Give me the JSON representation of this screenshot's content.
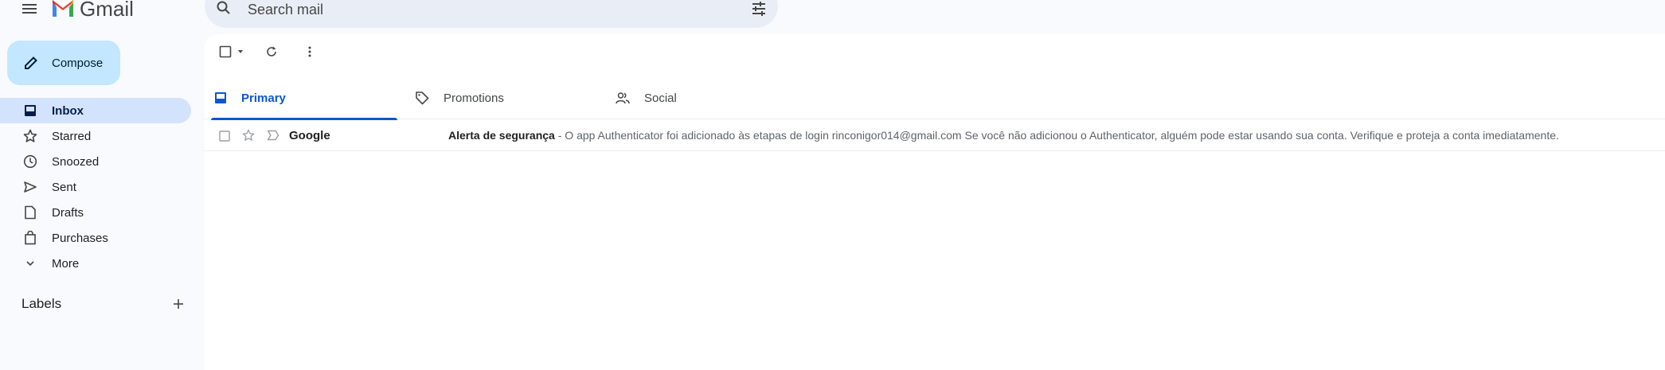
{
  "app": {
    "name": "Gmail"
  },
  "search": {
    "placeholder": "Search mail"
  },
  "compose": {
    "label": "Compose"
  },
  "nav": {
    "items": [
      {
        "label": "Inbox",
        "icon": "inbox-icon"
      },
      {
        "label": "Starred",
        "icon": "star-icon"
      },
      {
        "label": "Snoozed",
        "icon": "clock-icon"
      },
      {
        "label": "Sent",
        "icon": "send-icon"
      },
      {
        "label": "Drafts",
        "icon": "draft-icon"
      },
      {
        "label": "Purchases",
        "icon": "shopping-bag-icon"
      },
      {
        "label": "More",
        "icon": "chevron-down-icon"
      }
    ]
  },
  "labels": {
    "title": "Labels"
  },
  "tabs": [
    {
      "label": "Primary",
      "icon": "inbox-icon"
    },
    {
      "label": "Promotions",
      "icon": "tag-icon"
    },
    {
      "label": "Social",
      "icon": "people-icon"
    }
  ],
  "emails": [
    {
      "sender": "Google",
      "subject": "Alerta de segurança",
      "separator": " - ",
      "snippet": "O app Authenticator foi adicionado às etapas de login rinconigor014@gmail.com Se você não adicionou o Authenticator, alguém pode estar usando sua conta. Verifique e proteja a conta imediatamente."
    }
  ],
  "colors": {
    "accent": "#0b57d0",
    "compose_bg": "#c2e7ff",
    "active_nav_bg": "#d3e3fd",
    "background": "#f8fafd"
  }
}
